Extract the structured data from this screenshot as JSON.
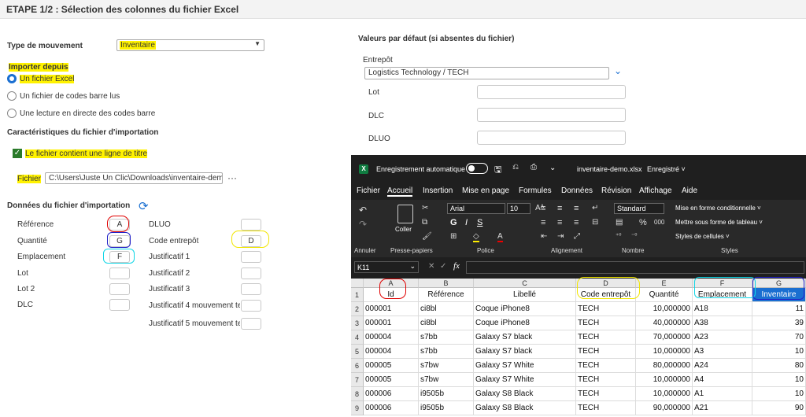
{
  "header": {
    "title": "ETAPE 1/2 : Sélection des colonnes du fichier Excel"
  },
  "left": {
    "type_mouvement_label": "Type de mouvement",
    "type_mouvement_value": "Inventaire",
    "importer_depuis_label": "Importer depuis",
    "import_options": [
      "Un fichier Excel",
      "Un fichier de codes barre lus",
      "Une lecture en directe des codes barre"
    ],
    "caracteristiques_label": "Caractéristiques du fichier d'importation",
    "titre_checkbox_label": "Le fichier contient une ligne de titre",
    "fichier_label": "Fichier",
    "fichier_path": "C:\\Users\\Juste Un Clic\\Downloads\\inventaire-demo.xlsx",
    "more_label": "···",
    "donnees_label": "Données du fichier d'importation",
    "fields_col1": [
      {
        "label": "Référence",
        "value": "A"
      },
      {
        "label": "Quantité",
        "value": "G"
      },
      {
        "label": "Emplacement",
        "value": "F"
      },
      {
        "label": "Lot",
        "value": ""
      },
      {
        "label": "Lot 2",
        "value": ""
      },
      {
        "label": "DLC",
        "value": ""
      }
    ],
    "fields_col2": [
      {
        "label": "DLUO",
        "value": ""
      },
      {
        "label": "Code entrepôt",
        "value": "D"
      },
      {
        "label": "Justificatif 1",
        "value": ""
      },
      {
        "label": "Justificatif 2",
        "value": ""
      },
      {
        "label": "Justificatif 3",
        "value": ""
      },
      {
        "label": "Justificatif 4 mouvement texte",
        "value": ""
      },
      {
        "label": "Justificatif 5 mouvement texte",
        "value": ""
      }
    ]
  },
  "right": {
    "defaults_label": "Valeurs par défaut (si absentes du fichier)",
    "entrepot_label": "Entrepôt",
    "entrepot_value": "Logistics Technology / TECH",
    "lot_label": "Lot",
    "dlc_label": "DLC",
    "dluo_label": "DLUO"
  },
  "excel": {
    "autosave_label": "Enregistrement automatique",
    "filename": "inventaire-demo.xlsx",
    "saved_status": "Enregistré ˅",
    "menu": [
      "Fichier",
      "Accueil",
      "Insertion",
      "Mise en page",
      "Formules",
      "Données",
      "Révision",
      "Affichage",
      "Aide"
    ],
    "ribbon": {
      "paste_label": "Coller",
      "font_name": "Arial",
      "font_size": "10",
      "number_format": "Standard",
      "percent": "%",
      "thousands": "000",
      "cond_format": "Mise en forme conditionnelle ˅",
      "table_format": "Mettre sous forme de tableau ˅",
      "cell_styles": "Styles de cellules ˅",
      "groups": [
        "Annuler",
        "Presse-papiers",
        "Police",
        "Alignement",
        "Nombre",
        "Styles"
      ]
    },
    "name_box": "K11",
    "fx": "fx",
    "columns": [
      "A",
      "B",
      "C",
      "D",
      "E",
      "F",
      "G"
    ],
    "rows": [
      [
        "Id",
        "Référence",
        "Libellé",
        "Code entrepôt",
        "Quantité",
        "Emplacement",
        "Inventaire"
      ],
      [
        "000001",
        "ci8bl",
        "Coque iPhone8",
        "TECH",
        "10,000000",
        "A18",
        "11"
      ],
      [
        "000001",
        "ci8bl",
        "Coque iPhone8",
        "TECH",
        "40,000000",
        "A38",
        "39"
      ],
      [
        "000004",
        "s7bb",
        "Galaxy S7 black",
        "TECH",
        "70,000000",
        "A23",
        "70"
      ],
      [
        "000004",
        "s7bb",
        "Galaxy S7 black",
        "TECH",
        "10,000000",
        "A3",
        "10"
      ],
      [
        "000005",
        "s7bw",
        "Galaxy S7 White",
        "TECH",
        "80,000000",
        "A24",
        "80"
      ],
      [
        "000005",
        "s7bw",
        "Galaxy S7 White",
        "TECH",
        "10,000000",
        "A4",
        "10"
      ],
      [
        "000006",
        "i9505b",
        "Galaxy S8 Black",
        "TECH",
        "10,000000",
        "A1",
        "10"
      ],
      [
        "000006",
        "i9505b",
        "Galaxy S8 Black",
        "TECH",
        "90,000000",
        "A21",
        "90"
      ]
    ],
    "row_numbers": [
      "1",
      "2",
      "3",
      "4",
      "5",
      "6",
      "7",
      "8",
      "9"
    ]
  },
  "colors": {
    "accent_blue": "#1a6fd1",
    "highlight": "#fff200",
    "excel_dark": "#1f1f1f",
    "excel_green": "#107c41"
  }
}
